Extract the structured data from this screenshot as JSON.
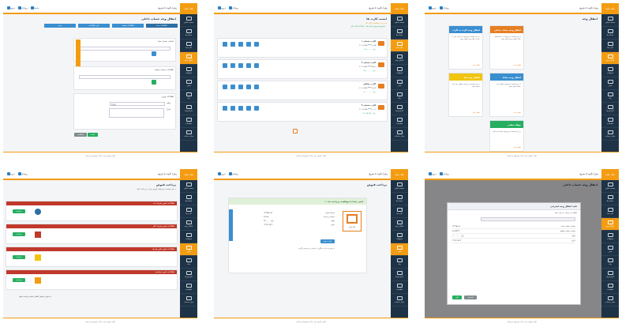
{
  "common": {
    "user_label": "زهرا دلاوند ۵ شریع",
    "side_logo": "بانک ملت",
    "footer_text": "کلیه حقوق برای بانک محفوظ می‌باشد",
    "topbar_items": [
      "خروج",
      "پروفایل",
      "پیام‌ها"
    ],
    "sidebar_items": [
      "صفحه اصلی",
      "حساب‌ها",
      "کارت‌ها",
      "انتقال وجه",
      "تسهیلات",
      "قبض",
      "چک",
      "گزارش‌ها",
      "تنظیمات",
      "سایر خدمات"
    ]
  },
  "panels": [
    {
      "title": "انتقال وجه",
      "active_side": 3,
      "tiles": [
        {
          "head": "انتقال وجه کارت به کارت",
          "color": "#3a8fd0",
          "body": "در این قسمت می‌توانید از کارت خود به کارت دیگر وجه انتقال دهید.",
          "link": "انتقال وجه"
        },
        {
          "head": "انتقال وجه حساب داخلی",
          "color": "#e67e22",
          "body": "در این قسمت می‌توانید به حساب‌های بانک انتقال وجه انجام دهید.",
          "link": "انتقال وجه"
        },
        {
          "head": "انتقال وجه پایا",
          "color": "#f1c40f",
          "body": "در این قسمت می‌توانید انتقال وجه پایا انجام دهید.",
          "link": "انتقال وجه"
        },
        {
          "head": "انتقال وجه ساتنا",
          "color": "#3a8fd0",
          "body": "در این قسمت می‌توانید انتقال وجه ساتنا انجام دهید.",
          "link": "انتقال وجه"
        },
        {
          "head": "حواله سفتی",
          "color": "#27ae60",
          "body": "در این قسمت می‌توانید حواله ثبت کنید.",
          "link": "انتقال وجه"
        }
      ]
    },
    {
      "title": "لیست کارت ها",
      "active_side": 2,
      "hint": "مدیریت و تنظیمات کارت‌ها",
      "subhint": "مجموع موجودی کارت‌ها: ۲۸۷,۹۸۳,۵۹۰ ریال",
      "cards": [
        {
          "name": "کارت شماره ۱",
          "number": "۶۱۰۴-۳۳۷۷-****-۱۲۴۵",
          "balance": "۱۲,۵۰۰,۰۰۰ ریال"
        },
        {
          "name": "کارت شماره ۲",
          "number": "۶۱۰۴-۳۳۷۷-****-۸۸۲۱",
          "balance": "۴۵,۰۰۰,۰۰۰ ریال"
        },
        {
          "name": "کارت رفاهی",
          "number": "۶۱۰۴-۳۳۷۷-****-۲۲۳۴",
          "balance": "۸۰,۰۰۰,۰۰۰ ریال"
        },
        {
          "name": "کارت شماره ۴",
          "number": "۶۱۰۴-۳۳۷۷-****-۹۰۱۱",
          "balance": "۱۵۰,۴۸۳,۵۹۰ ریال"
        }
      ]
    },
    {
      "title": "انتقال وجه حساب داخلی",
      "active_side": 3,
      "steps": [
        "اطلاعات مبدا",
        "اطلاعات مقصد",
        "تایید اطلاعات",
        "رسید"
      ],
      "section1": "انتخاب حساب مبدا",
      "section2": "اطلاعات حساب مقصد",
      "section3": "اطلاعات واریز",
      "amount_label": "مبلغ",
      "desc_label": "شرح",
      "amount_value": "(ریال)",
      "next": "ادامه",
      "back": "بازگشت"
    },
    {
      "title": "پرداخت قبوض",
      "active_side": 5,
      "hint": "در این قسمت می‌توانید قبوض خود را پرداخت کنید",
      "bills": [
        {
          "head": "اطلاعات قبض شرکت آب",
          "button": "پرداخت"
        },
        {
          "head": "اطلاعات قبض شرکت گاز",
          "button": "پرداخت"
        },
        {
          "head": "اطلاعات قبض تلفن همراه",
          "button": "پرداخت"
        },
        {
          "head": "اطلاعات قبض ایرانسل",
          "button": "پرداخت"
        }
      ],
      "footer_note": "به صورت قبض انتخاب شده پرداخت شود"
    },
    {
      "title": "پرداخت قبوض",
      "active_side": 5,
      "success": "قبض شما با موفقیت پرداخت شد",
      "receipt_logo": "بانک ملت",
      "fields": [
        {
          "label": "شناسه قبض",
          "value": "۱۲۳۴۵۶۷۸۹"
        },
        {
          "label": "شناسه پرداخت",
          "value": "۹۸۷۶۵"
        },
        {
          "label": "مبلغ",
          "value": "۲۵۰,۰۰۰ ریال"
        },
        {
          "label": "تاریخ",
          "value": "۱۳۹۷/۰۵/۱۲"
        }
      ],
      "print": "چاپ رسید",
      "note": "در صورت نیاز به پیگیری با شماره زیر تماس بگیرید"
    },
    {
      "title": "انتقال وجه حساب داخلی",
      "active_side": 3,
      "modal_title": "تایید انتقال وجه اینترنتی",
      "modal_text": "لطفا رمز حساب را وارد کنید",
      "confirm": "تایید",
      "cancel": "انصراف",
      "rows": [
        {
          "label": "شماره حساب مبدا",
          "value": "۱۲۳۴۵۶۷۸"
        },
        {
          "label": "شماره حساب مقصد",
          "value": "۸۷۶۵۴۳۲۱"
        },
        {
          "label": "مبلغ",
          "value": "۱,۰۰۰,۰۰۰ ریال"
        },
        {
          "label": "تاریخ",
          "value": "۱۳۹۷/۰۵/۱۲"
        }
      ]
    }
  ]
}
